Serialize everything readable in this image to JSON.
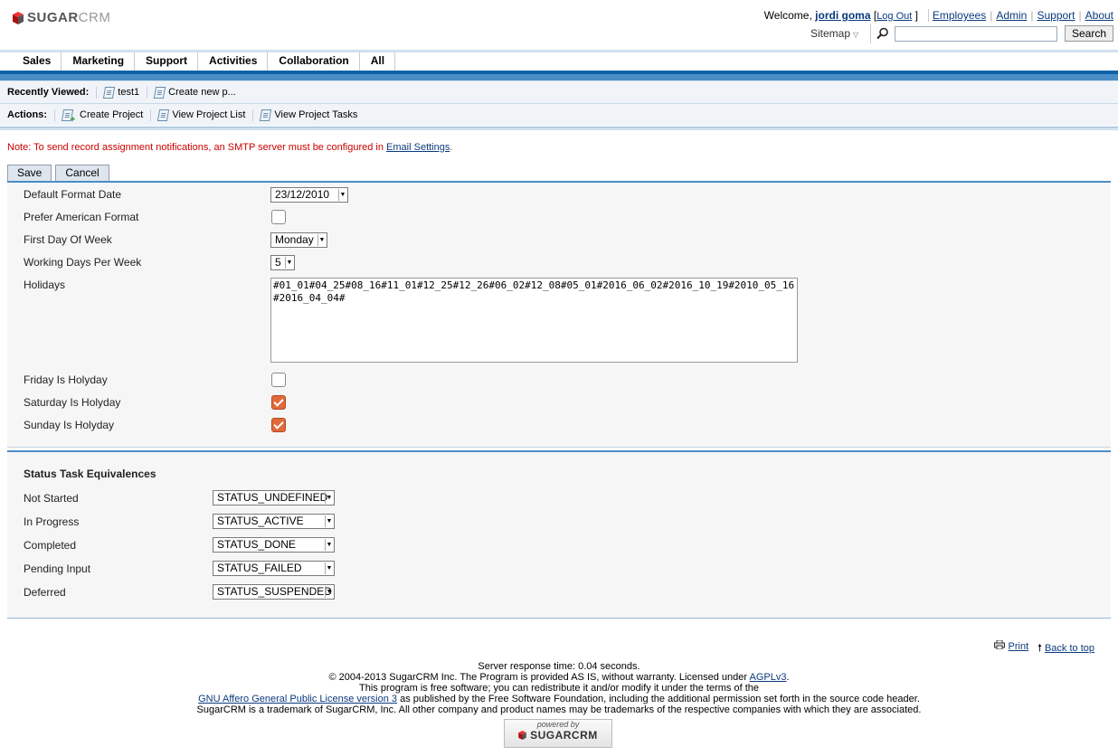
{
  "header": {
    "brand_main": "SUGAR",
    "brand_sub": "CRM",
    "welcome_prefix": "Welcome,",
    "user_name": "jordi goma",
    "logout": "Log Out",
    "links": [
      "Employees",
      "Admin",
      "Support",
      "About"
    ],
    "sitemap": "Sitemap",
    "search_button": "Search",
    "search_value": ""
  },
  "nav": [
    "Sales",
    "Marketing",
    "Support",
    "Activities",
    "Collaboration",
    "All"
  ],
  "recently_viewed": {
    "label": "Recently Viewed:",
    "items": [
      "test1",
      "Create new p..."
    ]
  },
  "actions": {
    "label": "Actions:",
    "items": [
      "Create Project",
      "View Project List",
      "View Project Tasks"
    ]
  },
  "note": {
    "text": "Note: To send record assignment notifications, an SMTP server must be configured in",
    "link": "Email Settings",
    "suffix": "."
  },
  "buttons": {
    "save": "Save",
    "cancel": "Cancel"
  },
  "form": {
    "default_format_date": {
      "label": "Default Format Date",
      "value": "23/12/2010"
    },
    "prefer_american": {
      "label": "Prefer American Format",
      "checked": false
    },
    "first_day_of_week": {
      "label": "First Day Of Week",
      "value": "Monday"
    },
    "working_days": {
      "label": "Working Days Per Week",
      "value": "5"
    },
    "holidays": {
      "label": "Holidays",
      "value": "#01_01#04_25#08_16#11_01#12_25#12_26#06_02#12_08#05_01#2016_06_02#2016_10_19#2010_05_16#2016_04_04#"
    },
    "friday": {
      "label": "Friday Is Holyday",
      "checked": false
    },
    "saturday": {
      "label": "Saturday Is Holyday",
      "checked": true
    },
    "sunday": {
      "label": "Sunday Is Holyday",
      "checked": true
    }
  },
  "status": {
    "title": "Status Task Equivalences",
    "rows": [
      {
        "label": "Not Started",
        "value": "STATUS_UNDEFINED"
      },
      {
        "label": "In Progress",
        "value": "STATUS_ACTIVE"
      },
      {
        "label": "Completed",
        "value": "STATUS_DONE"
      },
      {
        "label": "Pending Input",
        "value": "STATUS_FAILED"
      },
      {
        "label": "Deferred",
        "value": "STATUS_SUSPENDED"
      }
    ]
  },
  "footer": {
    "print": "Print",
    "back_to_top": "Back to top",
    "response": "Server response time: 0.04 seconds.",
    "copyright": "© 2004-2013 SugarCRM Inc. The Program is provided AS IS, without warranty. Licensed under",
    "agpl": "AGPLv3",
    "free_software": "This program is free software; you can redistribute it and/or modify it under the terms of the",
    "gnu_link": "GNU Affero General Public License version 3",
    "gnu_suffix": "as published by the Free Software Foundation, including the additional permission set forth in the source code header.",
    "trademark": "SugarCRM is a trademark of SugarCRM, Inc. All other company and product names may be trademarks of the respective companies with which they are associated.",
    "powered_by": "powered by",
    "powered_brand": "SUGARCRM"
  },
  "colors": {
    "accent": "#0a63a7",
    "checkbox_on": "#e06a3a",
    "note": "#cc0000"
  }
}
